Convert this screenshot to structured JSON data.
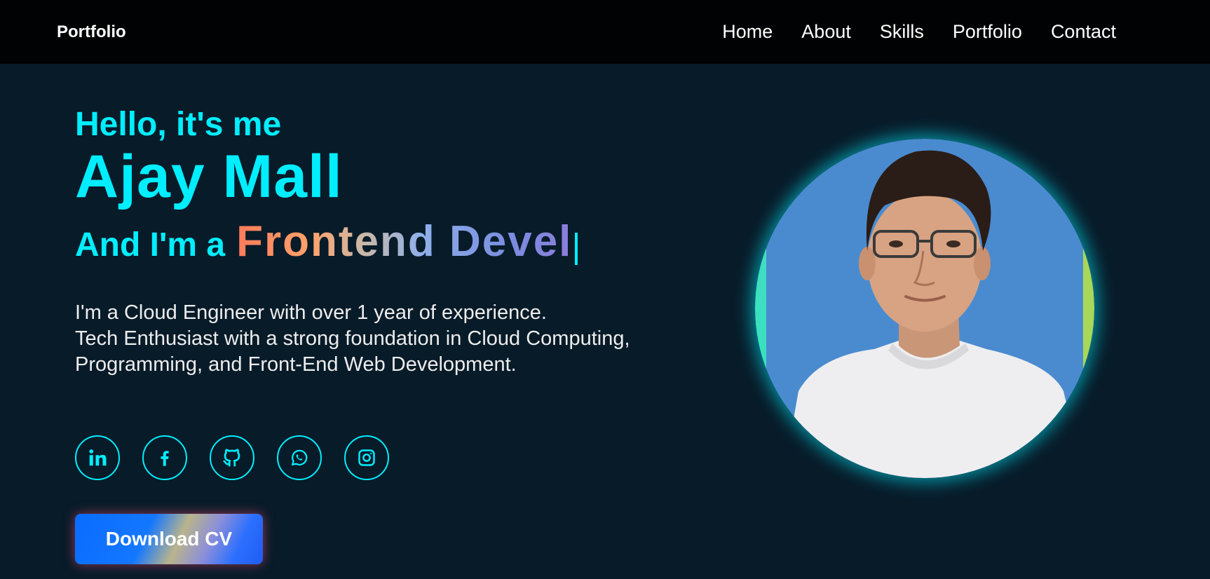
{
  "header": {
    "logo": "Portfolio",
    "nav": [
      "Home",
      "About",
      "Skills",
      "Portfolio",
      "Contact"
    ]
  },
  "hero": {
    "greeting": "Hello, it's me",
    "name": "Ajay Mall",
    "role_prefix": "And I'm a",
    "role_typed": "Frontend Devel",
    "bio": [
      "I'm a Cloud Engineer with over 1 year of experience.",
      "Tech Enthusiast with a strong foundation in Cloud Computing,",
      "Programming, and Front-End Web Development."
    ],
    "socials": [
      "linkedin-icon",
      "facebook-icon",
      "github-icon",
      "whatsapp-icon",
      "instagram-icon"
    ],
    "download_label": "Download CV"
  },
  "colors": {
    "background": "#081b29",
    "header": "#010203",
    "accent": "#00eeff",
    "text": "#ededed"
  }
}
